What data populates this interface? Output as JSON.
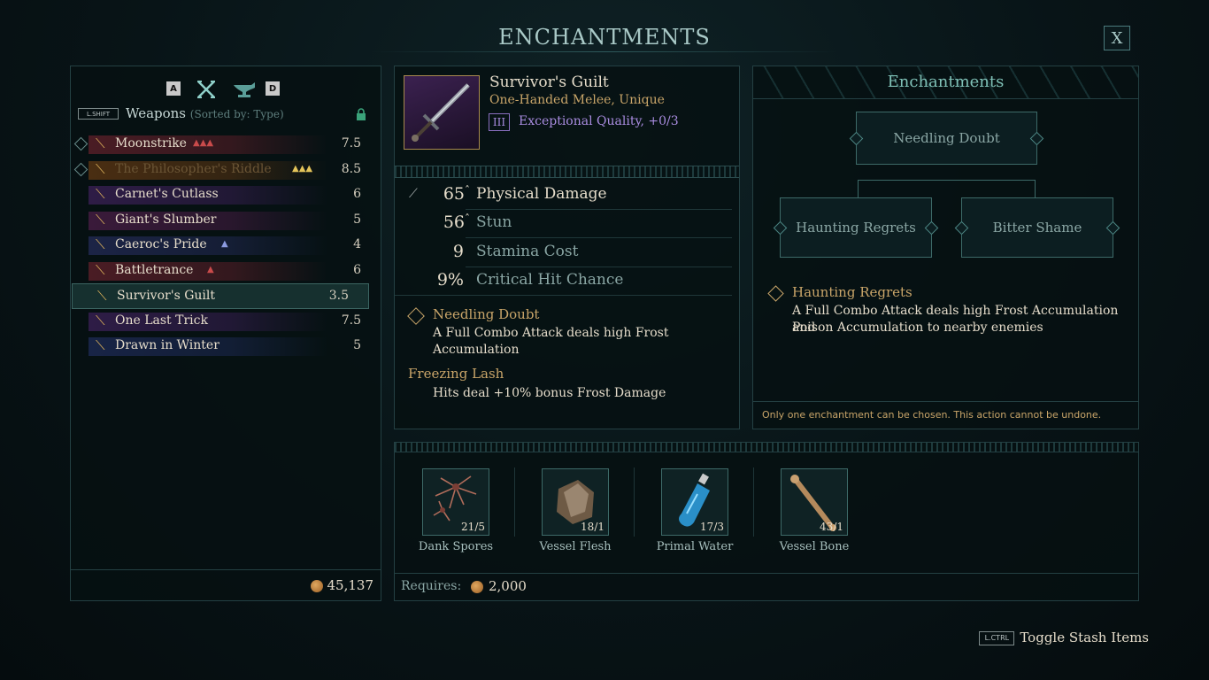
{
  "header": {
    "title": "ENCHANTMENTS",
    "close_label": "X"
  },
  "left_panel": {
    "key_left": "A",
    "key_right": "D",
    "shift_label": "L.SHIFT",
    "section_label": "Weapons",
    "sort_label": "(Sorted by: Type)",
    "weapons": [
      {
        "name": "Moonstrike",
        "value": "7.5",
        "tag": "▲▲▲",
        "tag_color": "red",
        "bg": "#4a1c24"
      },
      {
        "name": "The Philosopher's Riddle",
        "value": "8.5",
        "tag": "▲▲▲",
        "tag_color": "gold",
        "bg": "#4a2e12",
        "dim": true
      },
      {
        "name": "Carnet's Cutlass",
        "value": "6",
        "tag": "",
        "tag_color": "blue",
        "bg": "#2e1c46"
      },
      {
        "name": "Giant's Slumber",
        "value": "5",
        "tag": "",
        "tag_color": "blue",
        "bg": "#3a1a3a"
      },
      {
        "name": "Caeroc's Pride",
        "value": "4",
        "tag": "▲",
        "tag_color": "blue",
        "bg": "#1c2446"
      },
      {
        "name": "Battletrance",
        "value": "6",
        "tag": "▲",
        "tag_color": "red",
        "bg": "#4a1c24"
      },
      {
        "name": "Survivor's Guilt",
        "value": "3.5",
        "tag": "",
        "tag_color": "blue",
        "bg": "#16302f",
        "selected": true
      },
      {
        "name": "One Last Trick",
        "value": "7.5",
        "tag": "",
        "tag_color": "blue",
        "bg": "#2e1c46"
      },
      {
        "name": "Drawn in Winter",
        "value": "5",
        "tag": "",
        "tag_color": "blue",
        "bg": "#182446"
      }
    ],
    "gold": "45,137"
  },
  "item": {
    "name": "Survivor's Guilt",
    "type": "One-Handed Melee, Unique",
    "quality_tier": "III",
    "quality_text": "Exceptional Quality, +0/3",
    "stats": [
      {
        "value": "65",
        "label": "Physical Damage",
        "suffix": "ˆ"
      },
      {
        "value": "56",
        "label": "Stun",
        "suffix": "ˆ"
      },
      {
        "value": "9",
        "label": "Stamina Cost",
        "suffix": ""
      },
      {
        "value": "9%",
        "label": "Critical Hit Chance",
        "suffix": ""
      }
    ],
    "enchant_name": "Needling Doubt",
    "enchant_desc_1": "A Full Combo Attack deals high Frost",
    "enchant_desc_2": "Accumulation",
    "trait_name": "Freezing Lash",
    "trait_desc": "Hits deal +10% bonus Frost Damage"
  },
  "enchantments": {
    "header": "Enchantments",
    "current": "Needling Doubt",
    "option_left": "Haunting Regrets",
    "option_right": "Bitter Shame",
    "selected_name": "Haunting Regrets",
    "selected_desc_1": "A Full Combo Attack deals high Frost Accumulation and",
    "selected_desc_2": "Poison Accumulation to nearby enemies",
    "footer": "Only one enchantment can be chosen. This action cannot be undone."
  },
  "materials": {
    "items": [
      {
        "name": "Dank Spores",
        "count": "21/5"
      },
      {
        "name": "Vessel Flesh",
        "count": "18/1"
      },
      {
        "name": "Primal Water",
        "count": "17/3"
      },
      {
        "name": "Vessel Bone",
        "count": "43/1"
      }
    ],
    "requires_label": "Requires:",
    "requires_value": "2,000"
  },
  "footer": {
    "ctrl_label": "L.CTRL",
    "toggle_label": "Toggle Stash Items"
  }
}
